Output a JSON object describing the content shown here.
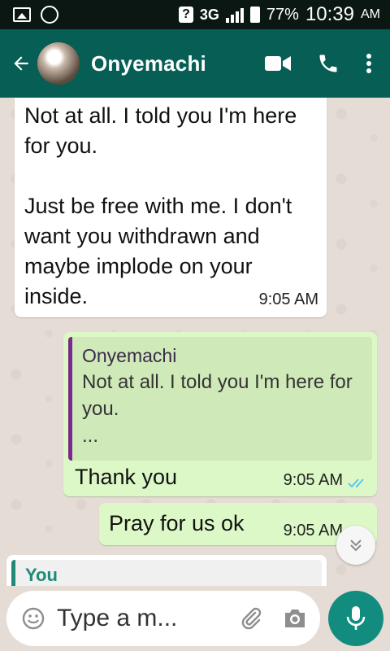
{
  "status_bar": {
    "network": "3G",
    "sim_badge": "?",
    "battery": "77%",
    "time": "10:39",
    "ampm": "AM"
  },
  "header": {
    "contact_name": "Onyemachi",
    "icons": [
      "back-arrow-icon",
      "avatar",
      "video-call-icon",
      "phone-icon",
      "more-vert-icon"
    ]
  },
  "messages": [
    {
      "direction": "incoming",
      "text": "Not at all. I told you I'm here for you.\n\nJust be free with me. I don't want you withdrawn and maybe implode on your inside.",
      "time": "9:05 AM"
    },
    {
      "direction": "outgoing",
      "quote_author": "Onyemachi",
      "quote_text": "Not at all. I told you I'm here for you.\n...",
      "text": "Thank you",
      "time": "9:05 AM",
      "status": "read"
    },
    {
      "direction": "outgoing",
      "text": "Pray for us ok",
      "time": "9:05 AM",
      "status": "read"
    },
    {
      "direction": "incoming",
      "quote_author": "You"
    }
  ],
  "composer": {
    "placeholder": "Type a m..."
  },
  "colors": {
    "header": "#075e54",
    "status_bar": "#0b1713",
    "outgoing_bubble": "#dcf8c6",
    "incoming_bubble": "#ffffff",
    "read_ticks": "#4fc3f7",
    "mic_button": "#128c7e"
  }
}
